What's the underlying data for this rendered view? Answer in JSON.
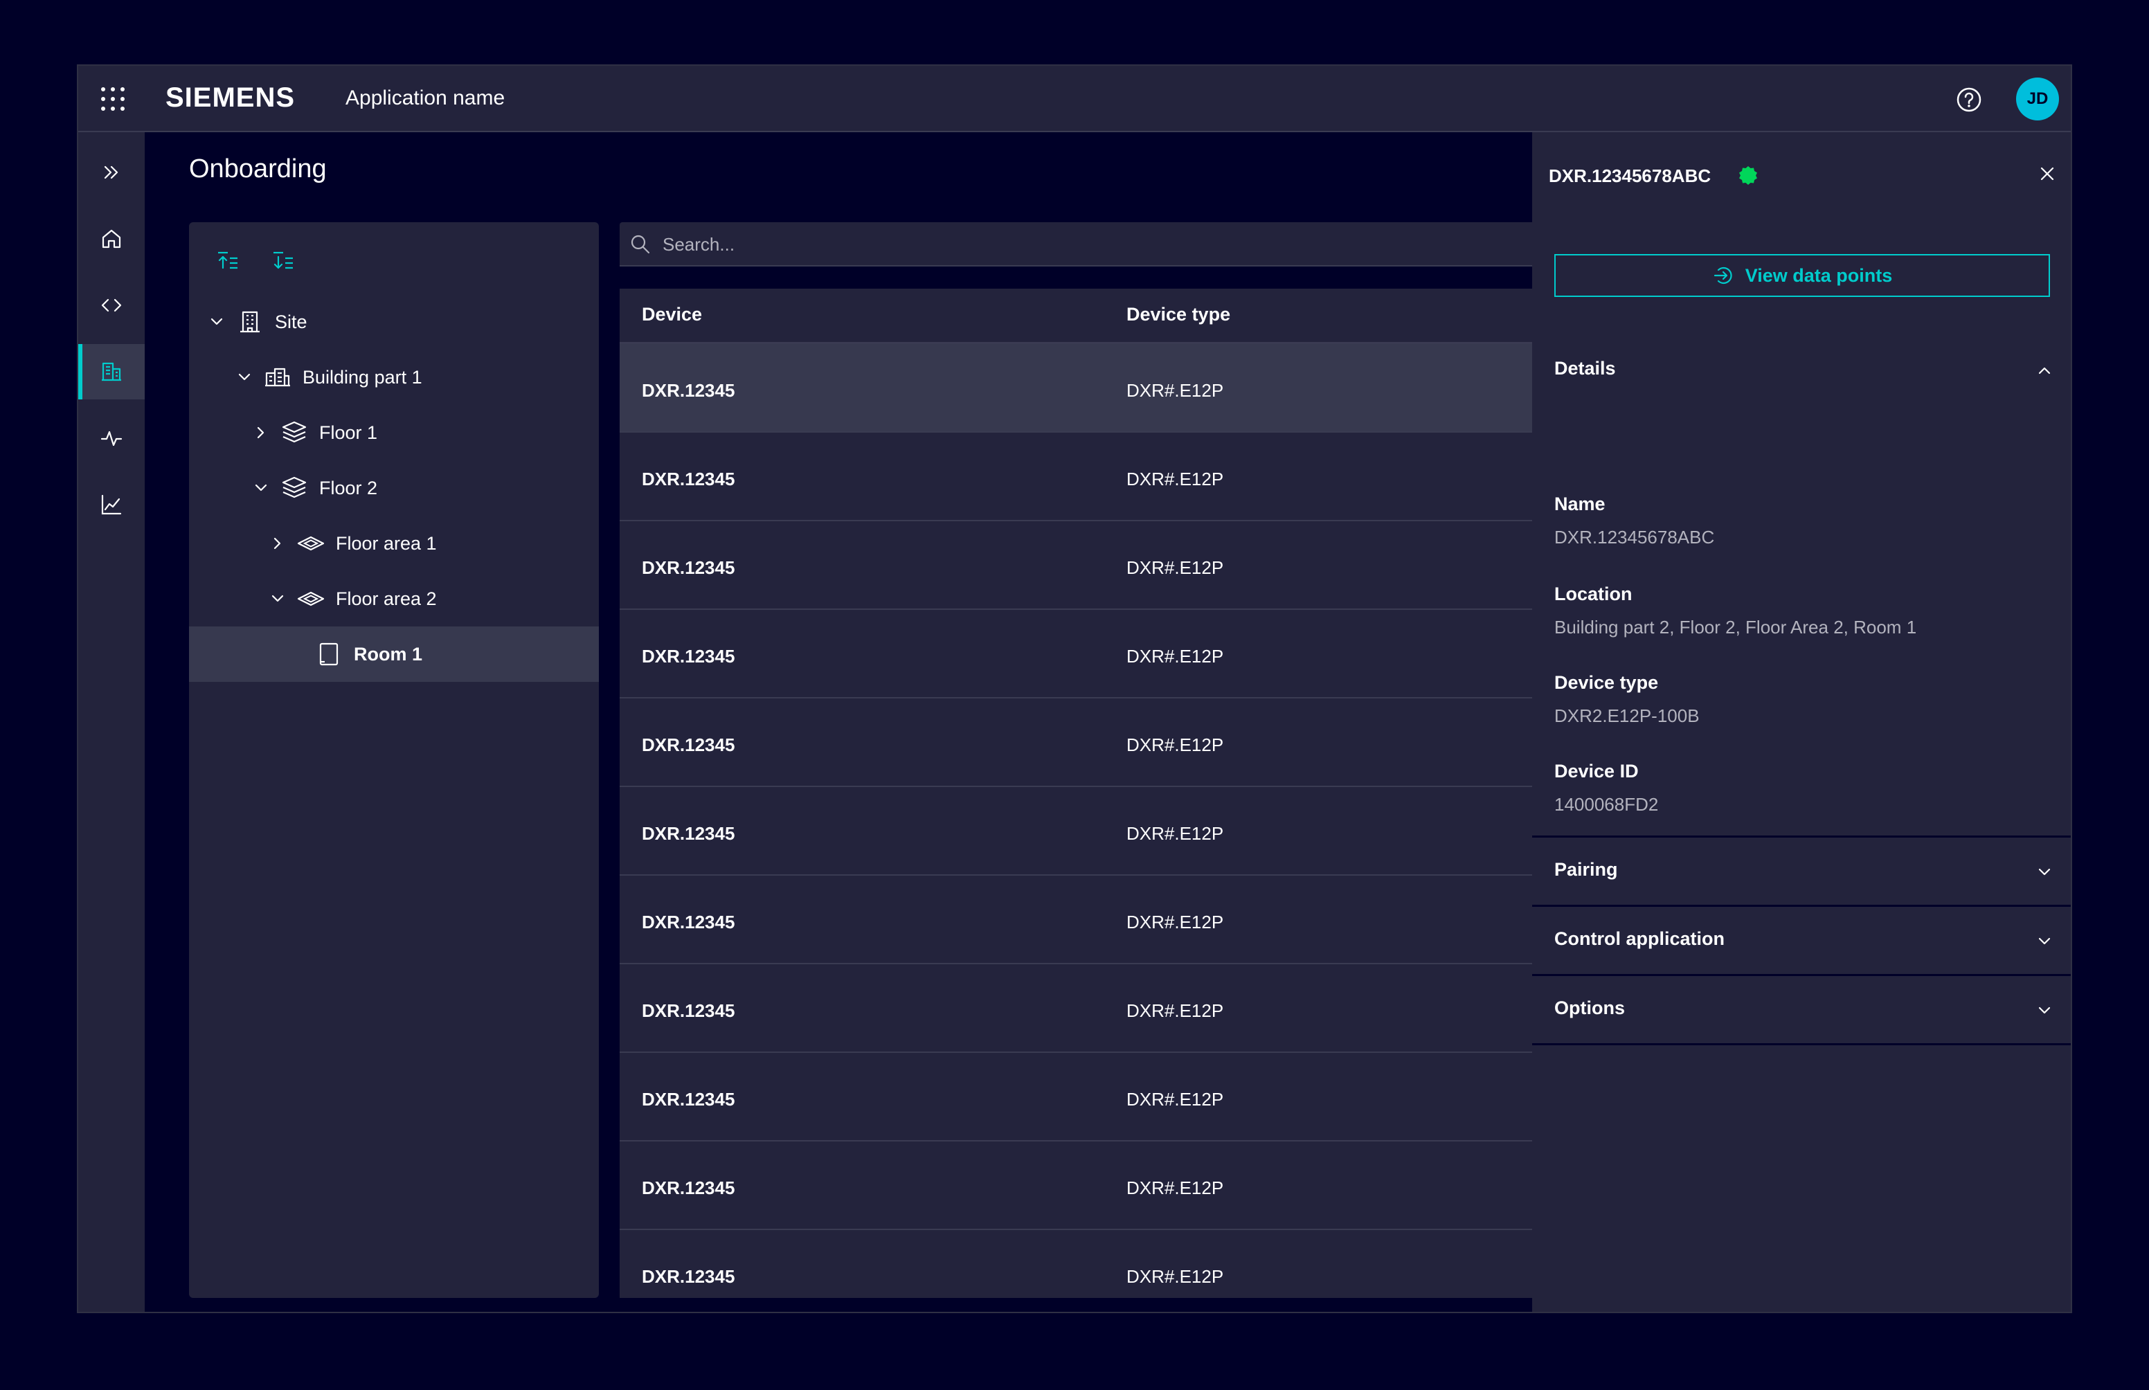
{
  "header": {
    "brand": "SIEMENS",
    "app_name": "Application name",
    "avatar_initials": "JD",
    "accent_color": "#00cccc"
  },
  "nav": {
    "items": [
      {
        "icon": "double-chevron-right-icon"
      },
      {
        "icon": "home-icon"
      },
      {
        "icon": "code-icon"
      },
      {
        "icon": "building-icon",
        "active": true
      },
      {
        "icon": "pulse-icon"
      },
      {
        "icon": "line-chart-icon"
      }
    ]
  },
  "page": {
    "title": "Onboarding"
  },
  "tree": {
    "tools": [
      "collapse-all-icon",
      "expand-all-icon"
    ],
    "nodes": [
      {
        "label": "Site",
        "icon": "building-icon",
        "level": 0,
        "expanded": true
      },
      {
        "label": "Building part 1",
        "icon": "building-part-icon",
        "level": 1,
        "expanded": true
      },
      {
        "label": "Floor 1",
        "icon": "floor-icon",
        "level": 2,
        "expanded": false
      },
      {
        "label": "Floor 2",
        "icon": "floor-icon",
        "level": 2,
        "expanded": true
      },
      {
        "label": "Floor area 1",
        "icon": "floor-area-icon",
        "level": 3,
        "expanded": false
      },
      {
        "label": "Floor area 2",
        "icon": "floor-area-icon",
        "level": 3,
        "expanded": true
      },
      {
        "label": "Room 1",
        "icon": "room-icon",
        "level": 4,
        "selected": true
      }
    ]
  },
  "search": {
    "placeholder": "Search...",
    "value": ""
  },
  "table": {
    "columns": [
      "Device",
      "Device type"
    ],
    "rows": [
      {
        "device": "DXR.12345",
        "type": "DXR#.E12P"
      },
      {
        "device": "DXR.12345",
        "type": "DXR#.E12P"
      },
      {
        "device": "DXR.12345",
        "type": "DXR#.E12P"
      },
      {
        "device": "DXR.12345",
        "type": "DXR#.E12P"
      },
      {
        "device": "DXR.12345",
        "type": "DXR#.E12P"
      },
      {
        "device": "DXR.12345",
        "type": "DXR#.E12P"
      },
      {
        "device": "DXR.12345",
        "type": "DXR#.E12P"
      },
      {
        "device": "DXR.12345",
        "type": "DXR#.E12P"
      },
      {
        "device": "DXR.12345",
        "type": "DXR#.E12P"
      },
      {
        "device": "DXR.12345",
        "type": "DXR#.E12P"
      },
      {
        "device": "DXR.12345",
        "type": "DXR#.E12P"
      }
    ]
  },
  "flyout": {
    "title": "DXR.12345678ABC",
    "status_color": "#01d65a",
    "view_data_points_label": "View data points",
    "details_header": "Details",
    "details": [
      {
        "label": "Name",
        "value": "DXR.12345678ABC"
      },
      {
        "label": "Location",
        "value": "Building part 2, Floor 2, Floor Area 2, Room 1"
      },
      {
        "label": "Device type",
        "value": "DXR2.E12P-100B"
      },
      {
        "label": "Device ID",
        "value": "1400068FD2"
      }
    ],
    "sections": [
      "Pairing",
      "Control application",
      "Options"
    ]
  }
}
